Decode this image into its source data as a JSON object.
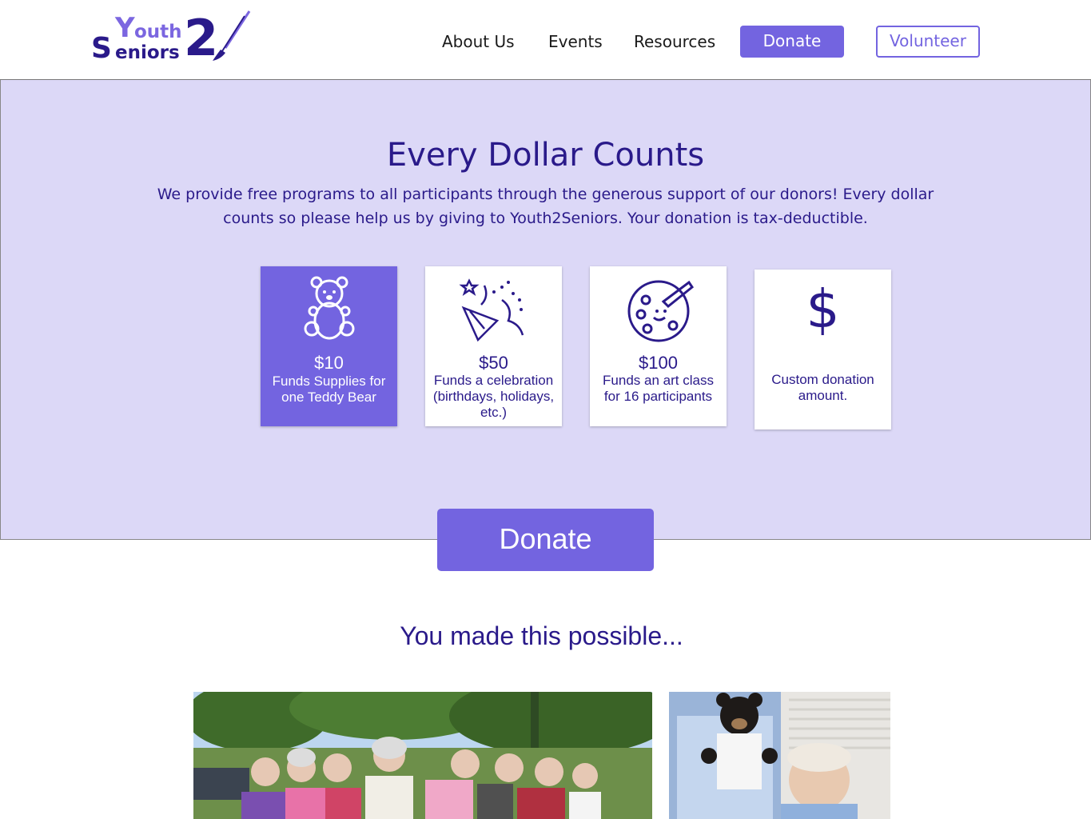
{
  "header": {
    "logo": {
      "y": "Y",
      "outh": "outh",
      "s": "S",
      "eniors": "eniors",
      "two": "2"
    },
    "nav": [
      "About Us",
      "Events",
      "Resources"
    ],
    "donate_label": "Donate",
    "volunteer_label": "Volunteer"
  },
  "hero": {
    "title": "Every Dollar Counts",
    "subtitle": "We provide free programs to all participants through the generous support of our donors!  Every dollar counts so please help us by giving to Youth2Seniors.  Your donation is tax-deductible.",
    "cards": [
      {
        "icon": "teddy-bear-icon",
        "amount": "$10",
        "desc": "Funds Supplies for one Teddy Bear"
      },
      {
        "icon": "party-popper-icon",
        "amount": "$50",
        "desc": "Funds a celebration (birthdays, holidays, etc.)"
      },
      {
        "icon": "paint-palette-icon",
        "amount": "$100",
        "desc": "Funds an art class for 16 participants"
      },
      {
        "icon": "dollar-sign-icon",
        "amount": "$",
        "desc": "Custom donation amount."
      }
    ]
  },
  "donate_main_label": "Donate",
  "possible_title": "You made this possible...",
  "colors": {
    "accent": "#7364e0",
    "dark": "#2a1a8a",
    "hero_bg": "#dcd8f7"
  }
}
